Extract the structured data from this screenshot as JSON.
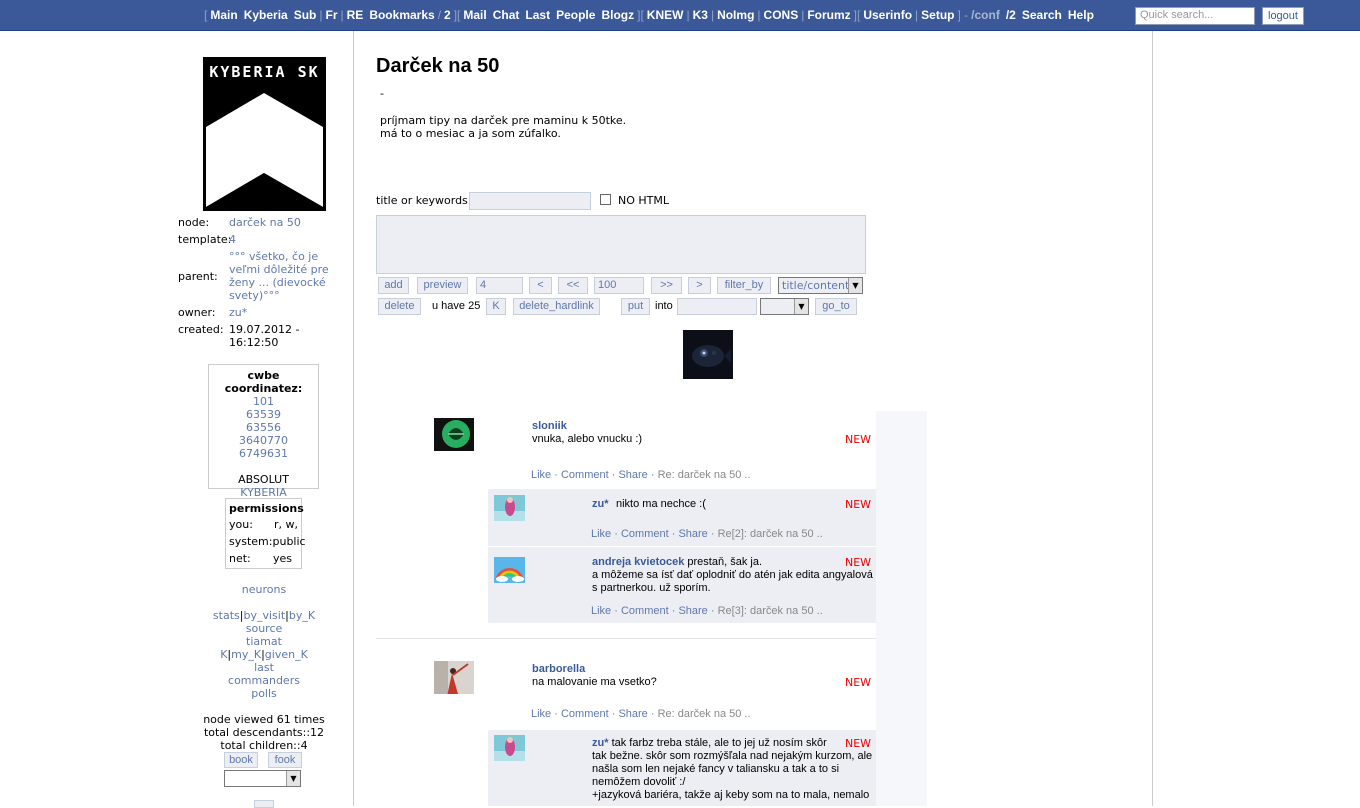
{
  "topnav": {
    "items": [
      {
        "label": "Main"
      },
      {
        "label": "Kyberia"
      },
      {
        "label": "Sub"
      },
      {
        "label": "Fr"
      },
      {
        "label": "RE"
      },
      {
        "label": "Bookmarks"
      },
      {
        "label": "2"
      },
      {
        "label": "Mail"
      },
      {
        "label": "Chat"
      },
      {
        "label": "Last"
      },
      {
        "label": "People"
      },
      {
        "label": "Blogz"
      },
      {
        "label": "KNEW"
      },
      {
        "label": "K3"
      },
      {
        "label": "NoImg"
      },
      {
        "label": "CONS"
      },
      {
        "label": "Forumz"
      },
      {
        "label": "Userinfo"
      },
      {
        "label": "Setup"
      },
      {
        "label": "/conf"
      },
      {
        "label": "/2"
      },
      {
        "label": "Search"
      },
      {
        "label": "Help"
      }
    ],
    "search_placeholder": "Quick search...",
    "logout_label": "logout"
  },
  "sidebar": {
    "logo_text": "KYBERIA SK",
    "node_label": "node:",
    "node_value": "darček na 50",
    "template_label": "template:",
    "template_value": "4",
    "parent_label": "parent:",
    "parent_value": "°°° všetko, čo je veľmi dôležité pre ženy ... (dievocké svety)°°°",
    "owner_label": "owner:",
    "owner_value": "zu*",
    "created_label": "created:",
    "created_value": "19.07.2012 - 16:12:50",
    "cwbe": {
      "title": "cwbe coordinatez:",
      "coords": [
        "101",
        "63539",
        "63556",
        "3640770",
        "6749631"
      ],
      "absolut": "ABSOLUT",
      "kyberia": "KYBERIA"
    },
    "permissions": {
      "title": "permissions",
      "you_label": "you:",
      "you_value": "r, w,",
      "system_label": "system:",
      "system_value": "public",
      "net_label": "net:",
      "net_value": "yes"
    },
    "links": {
      "neurons": "neurons",
      "stats": "stats",
      "by_visit": "by_visit",
      "by_k": "by_K",
      "source": "source",
      "tiamat": "tiamat",
      "k": "K",
      "my_k": "my_K",
      "given_k": "given_K",
      "last": "last",
      "commanders": "commanders",
      "polls": "polls"
    },
    "stats": {
      "viewed": "node viewed 61 times",
      "descendants": "total descendants::12",
      "children": "total children::4"
    },
    "book_label": "book",
    "fook_label": "fook"
  },
  "main": {
    "title": "Darček na 50",
    "dash": "-",
    "content_line1": "príjmam tipy na darček pre maminu k 50tke.",
    "content_line2": "má to o mesiac a ja som zúfalko.",
    "keywords_label": "title or keywords::",
    "nohtml_label": "NO HTML",
    "controls": {
      "add": "add",
      "preview": "preview",
      "page_value": "4",
      "prev": "<",
      "first": "<<",
      "count_value": "100",
      "last": ">>",
      "next": ">",
      "filter_by": "filter_by",
      "filter_select": "title/content",
      "delete": "delete",
      "u_have": "u have 25",
      "k": "K",
      "delete_hardlink": "delete_hardlink",
      "put": "put",
      "into": "into",
      "go_to": "go_to"
    }
  },
  "posts": [
    {
      "author": "sloniik",
      "text": "vnuka, alebo vnucku :)",
      "new": "NEW",
      "like": "Like",
      "comment": "Comment",
      "share": "Share",
      "re": "Re: darček na 50 .."
    },
    {
      "author": "zu*",
      "text": "nikto ma nechce :(",
      "new": "NEW",
      "like": "Like",
      "comment": "Comment",
      "share": "Share",
      "re": "Re[2]: darček na 50 .."
    },
    {
      "author": "andreja kvietocek",
      "text_inline": "prestaň, šak ja.",
      "text_line2": "a môžeme sa ísť dať oplodniť do atén jak edita angyalová",
      "text_line3": "s partnerkou. už sporím.",
      "new": "NEW",
      "like": "Like",
      "comment": "Comment",
      "share": "Share",
      "re": "Re[3]: darček na 50 .."
    },
    {
      "author": "barborella",
      "text": "na malovanie ma vsetko?",
      "new": "NEW",
      "like": "Like",
      "comment": "Comment",
      "share": "Share",
      "re": "Re: darček na 50 .."
    },
    {
      "author": "zu*",
      "text_inline": "tak farbz treba stále, ale to jej už nosím skôr",
      "text_line2": "tak bežne. skôr som rozmýšľala nad nejakým kurzom, ale",
      "text_line3": "našla som len nejaké fancy v taliansku a tak a to si",
      "text_line4": "nemôžem dovoliť :/",
      "text_line5": "+jazyková bariéra, takže aj keby som na to mala, nemalo",
      "new": "NEW"
    }
  ]
}
